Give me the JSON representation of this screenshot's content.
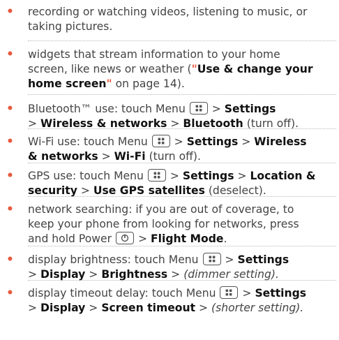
{
  "items": [
    {
      "lines": [
        [
          {
            "t": "recording or watching videos, listening to music, or"
          }
        ],
        [
          {
            "t": "taking pictures."
          }
        ]
      ]
    },
    {
      "lines": [
        [
          {
            "t": "widgets that stream information to your home"
          }
        ],
        [
          {
            "t": "screen, like news or weather (\""
          },
          {
            "t": "Use & change your",
            "s": "b"
          }
        ],
        [
          {
            "t": "home screen",
            "s": "b"
          },
          {
            "t": "\" on page 14)."
          }
        ]
      ]
    },
    {
      "lines": [
        [
          {
            "t": "Bluetooth™ use: touch Menu "
          },
          {
            "icon": "menu-key-icon"
          },
          {
            "t": " > "
          },
          {
            "t": "Settings",
            "s": "b"
          }
        ],
        [
          {
            "t": "> "
          },
          {
            "t": "Wireless & networks",
            "s": "b"
          },
          {
            "t": " > "
          },
          {
            "t": "Bluetooth",
            "s": "b"
          },
          {
            "t": " (turn off)."
          }
        ]
      ]
    },
    {
      "lines": [
        [
          {
            "t": "Wi-Fi use: touch Menu "
          },
          {
            "icon": "menu-key-icon"
          },
          {
            "t": " > "
          },
          {
            "t": "Settings",
            "s": "b"
          },
          {
            "t": " > "
          },
          {
            "t": "Wireless",
            "s": "b"
          }
        ],
        [
          {
            "t": "& networks",
            "s": "b"
          },
          {
            "t": " > "
          },
          {
            "t": "Wi-Fi",
            "s": "b"
          },
          {
            "t": " (turn off)."
          }
        ]
      ]
    },
    {
      "lines": [
        [
          {
            "t": "GPS use: touch Menu "
          },
          {
            "icon": "menu-key-icon"
          },
          {
            "t": " > "
          },
          {
            "t": "Settings",
            "s": "b"
          },
          {
            "t": " > "
          },
          {
            "t": "Location &",
            "s": "b"
          }
        ],
        [
          {
            "t": "security",
            "s": "b"
          },
          {
            "t": " > "
          },
          {
            "t": "Use GPS satellites",
            "s": "b"
          },
          {
            "t": " (deselect)."
          }
        ]
      ]
    },
    {
      "lines": [
        [
          {
            "t": "network searching: if you are out of coverage, to"
          }
        ],
        [
          {
            "t": "keep your phone from looking for networks, press"
          }
        ],
        [
          {
            "t": "and hold Power "
          },
          {
            "icon": "power-key-icon"
          },
          {
            "t": " > "
          },
          {
            "t": "Flight Mode",
            "s": "b"
          },
          {
            "t": "."
          }
        ]
      ]
    },
    {
      "lines": [
        [
          {
            "t": "display brightness: touch Menu "
          },
          {
            "icon": "menu-key-icon"
          },
          {
            "t": " > "
          },
          {
            "t": "Settings",
            "s": "b"
          }
        ],
        [
          {
            "t": "> "
          },
          {
            "t": "Display",
            "s": "b"
          },
          {
            "t": " > "
          },
          {
            "t": "Brightness",
            "s": "b"
          },
          {
            "t": " > "
          },
          {
            "t": "(dimmer setting).",
            "s": "i"
          }
        ]
      ]
    },
    {
      "lines": [
        [
          {
            "t": "display timeout delay: touch Menu "
          },
          {
            "icon": "menu-key-icon"
          },
          {
            "t": " > "
          },
          {
            "t": "Settings",
            "s": "b"
          }
        ],
        [
          {
            "t": "> "
          },
          {
            "t": "Display",
            "s": "b"
          },
          {
            "t": " > "
          },
          {
            "t": "Screen timeout",
            "s": "b"
          },
          {
            "t": " > "
          },
          {
            "t": "(shorter setting).",
            "s": "i"
          }
        ]
      ]
    }
  ],
  "bullet_char": "•",
  "colors": {
    "bullet": "#e8593f",
    "text": "#444444",
    "bold": "#111111",
    "rule": "#b8b8b8"
  }
}
